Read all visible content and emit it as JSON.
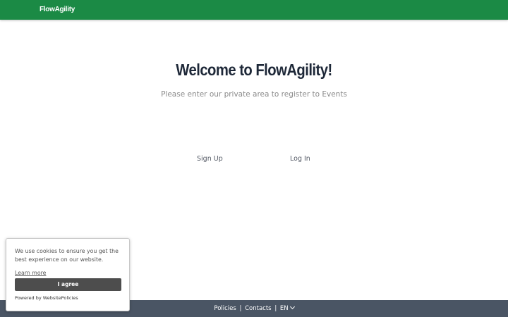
{
  "navbar": {
    "brand": "FlowAgility",
    "color": "#1b8a45"
  },
  "hero": {
    "title": "Welcome to FlowAgility!",
    "subtitle": "Please enter our private area to register to Events"
  },
  "auth": {
    "signup_label": "Sign Up",
    "login_label": "Log In"
  },
  "footer": {
    "policies_label": "Policies",
    "separator": "|",
    "contacts_label": "Contacts",
    "language_label": "EN",
    "color": "#4a5564"
  },
  "cookie_banner": {
    "message": "We use cookies to ensure you get the best experience on our website.",
    "learn_more_label": "Learn more",
    "agree_label": "I agree",
    "powered_by": "Powered by WebsitePolicies"
  }
}
